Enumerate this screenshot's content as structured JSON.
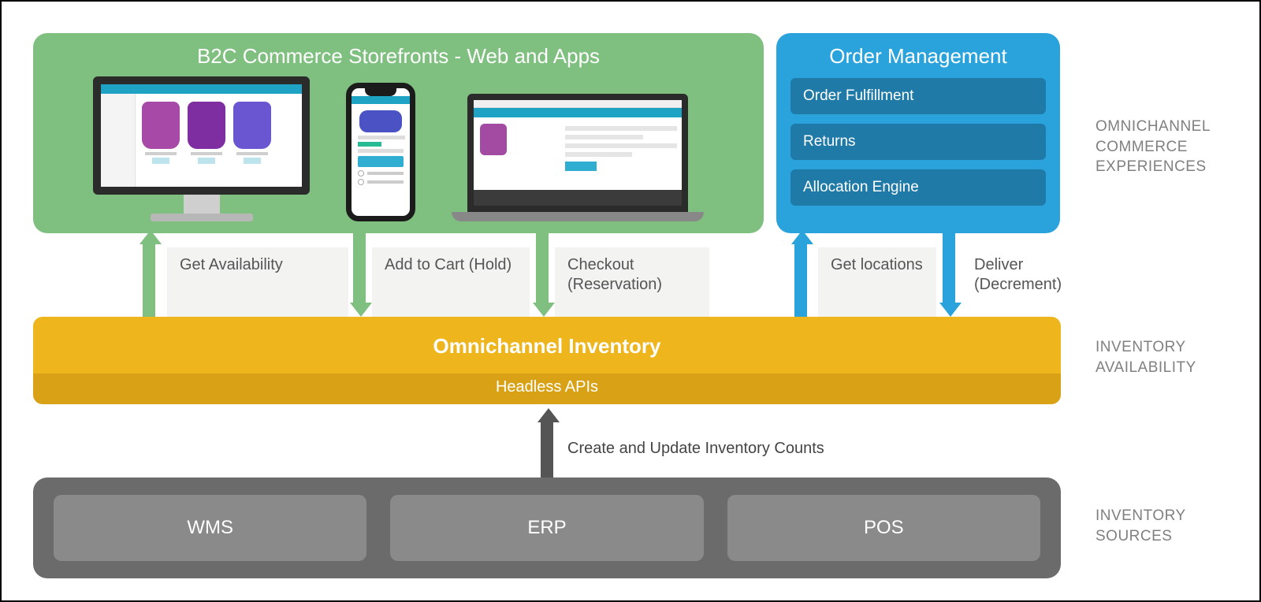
{
  "storefronts": {
    "title": "B2C Commerce Storefronts - Web and Apps"
  },
  "order_management": {
    "title": "Order Management",
    "items": [
      "Order Fulfillment",
      "Returns",
      "Allocation Engine"
    ]
  },
  "flows": {
    "get_availability": "Get Availability",
    "add_to_cart": "Add to Cart (Hold)",
    "checkout": "Checkout (Reservation)",
    "get_locations": "Get locations",
    "deliver": "Deliver (Decrement)"
  },
  "inventory": {
    "title": "Omnichannel Inventory",
    "subtitle": "Headless APIs"
  },
  "midflow": {
    "label": "Create and Update Inventory Counts"
  },
  "sources": {
    "items": [
      "WMS",
      "ERP",
      "POS"
    ]
  },
  "right_labels": {
    "experiences": "OMNICHANNEL COMMERCE EXPERIENCES",
    "availability": "INVENTORY AVAILABILITY",
    "sources": "INVENTORY SOURCES"
  }
}
